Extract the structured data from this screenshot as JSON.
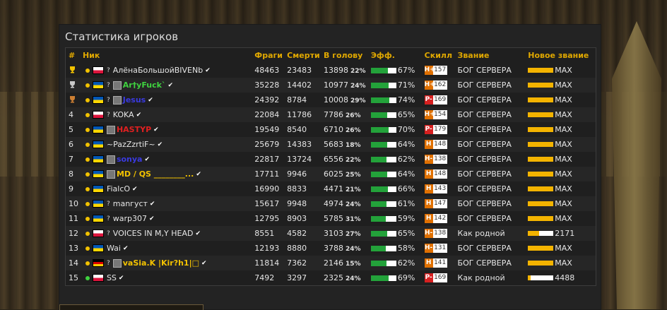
{
  "panel": {
    "title": "Статистика игроков"
  },
  "headers": {
    "num": "#",
    "nick": "Ник",
    "frags": "Фраги",
    "deaths": "Смерти",
    "hs": "В голову",
    "eff": "Эфф.",
    "skill": "Скилл",
    "rank": "Звание",
    "newrank": "Новое звание"
  },
  "colors": {
    "header": "#e0a800",
    "eff_bar": "#23a23a",
    "rank_bar": "#f4b400",
    "skill_h": "#e07000",
    "skill_p": "#d62020"
  },
  "rows": [
    {
      "num": "",
      "trophy": "gold-trophy-icon",
      "dot": "#f2c200",
      "flag": "poland",
      "q": "?",
      "avatar": "",
      "nick": "АлёнаБольшойBIVENb",
      "nick_color": "#e6e6e6",
      "frags": "48463",
      "deaths": "23483",
      "hs": "13898",
      "hs_pct": "22%",
      "eff": "67%",
      "eff_val": 0.67,
      "skill_letter": "H+",
      "skill_color": "#e07000",
      "skill": "157",
      "rank": "БОГ СЕРВЕРА",
      "newrank": "MAX",
      "newrank_val": 1.0
    },
    {
      "num": "",
      "trophy": "silver-trophy-icon",
      "dot": "#f2c200",
      "flag": "ukraine",
      "q": "?",
      "avatar": "avatar-icon",
      "nick": "Ar†yFuck`",
      "nick_color": "#3fd23f",
      "frags": "35228",
      "deaths": "14402",
      "hs": "10977",
      "hs_pct": "24%",
      "eff": "71%",
      "eff_val": 0.71,
      "skill_letter": "H+",
      "skill_color": "#e07000",
      "skill": "162",
      "rank": "БОГ СЕРВЕРА",
      "newrank": "MAX",
      "newrank_val": 1.0
    },
    {
      "num": "",
      "trophy": "bronze-trophy-icon",
      "dot": "#f2c200",
      "flag": "ukraine",
      "q": "?",
      "avatar": "avatar-icon",
      "nick": "Jesus",
      "nick_color": "#3a3ae0",
      "frags": "24392",
      "deaths": "8784",
      "hs": "10008",
      "hs_pct": "29%",
      "eff": "74%",
      "eff_val": 0.74,
      "skill_letter": "P-",
      "skill_color": "#d62020",
      "skill": "169",
      "rank": "БОГ СЕРВЕРА",
      "newrank": "MAX",
      "newrank_val": 1.0
    },
    {
      "num": "4",
      "trophy": "",
      "dot": "#f2c200",
      "flag": "poland",
      "q": "?",
      "avatar": "",
      "nick": "KOKA",
      "nick_color": "#e6e6e6",
      "frags": "22084",
      "deaths": "11786",
      "hs": "7786",
      "hs_pct": "26%",
      "eff": "65%",
      "eff_val": 0.65,
      "skill_letter": "H+",
      "skill_color": "#e07000",
      "skill": "154",
      "rank": "БОГ СЕРВЕРА",
      "newrank": "MAX",
      "newrank_val": 1.0
    },
    {
      "num": "5",
      "trophy": "",
      "dot": "#f2c200",
      "flag": "ukraine",
      "q": "",
      "avatar": "avatar-icon",
      "nick": "HASTYP",
      "nick_color": "#e02020",
      "frags": "19549",
      "deaths": "8540",
      "hs": "6710",
      "hs_pct": "26%",
      "eff": "70%",
      "eff_val": 0.7,
      "skill_letter": "P-",
      "skill_color": "#d62020",
      "skill": "179",
      "rank": "БОГ СЕРВЕРА",
      "newrank": "MAX",
      "newrank_val": 1.0
    },
    {
      "num": "6",
      "trophy": "",
      "dot": "#f2c200",
      "flag": "ukraine",
      "q": "",
      "avatar": "",
      "nick": "~PazZzrtiF~",
      "nick_color": "#e6e6e6",
      "frags": "25679",
      "deaths": "14383",
      "hs": "5683",
      "hs_pct": "18%",
      "eff": "64%",
      "eff_val": 0.64,
      "skill_letter": "H",
      "skill_color": "#e07000",
      "skill": "148",
      "rank": "БОГ СЕРВЕРА",
      "newrank": "MAX",
      "newrank_val": 1.0
    },
    {
      "num": "7",
      "trophy": "",
      "dot": "#f2c200",
      "flag": "ukraine",
      "q": "",
      "avatar": "avatar-icon",
      "nick": "sonya",
      "nick_color": "#3a3ae0",
      "frags": "22817",
      "deaths": "13724",
      "hs": "6556",
      "hs_pct": "22%",
      "eff": "62%",
      "eff_val": 0.62,
      "skill_letter": "H-",
      "skill_color": "#e07000",
      "skill": "138",
      "rank": "БОГ СЕРВЕРА",
      "newrank": "MAX",
      "newrank_val": 1.0
    },
    {
      "num": "8",
      "trophy": "",
      "dot": "#f2c200",
      "flag": "ukraine",
      "q": "",
      "avatar": "avatar-icon",
      "nick": "MD / QS ________...",
      "nick_color": "#f2c200",
      "frags": "17711",
      "deaths": "9946",
      "hs": "6025",
      "hs_pct": "25%",
      "eff": "64%",
      "eff_val": 0.64,
      "skill_letter": "H",
      "skill_color": "#e07000",
      "skill": "148",
      "rank": "БОГ СЕРВЕРА",
      "newrank": "MAX",
      "newrank_val": 1.0
    },
    {
      "num": "9",
      "trophy": "",
      "dot": "#f2c200",
      "flag": "ukraine",
      "q": "",
      "avatar": "",
      "nick": "FialcO",
      "nick_color": "#e6e6e6",
      "frags": "16990",
      "deaths": "8833",
      "hs": "4471",
      "hs_pct": "21%",
      "eff": "66%",
      "eff_val": 0.66,
      "skill_letter": "H",
      "skill_color": "#e07000",
      "skill": "143",
      "rank": "БОГ СЕРВЕРА",
      "newrank": "MAX",
      "newrank_val": 1.0
    },
    {
      "num": "10",
      "trophy": "",
      "dot": "#f2c200",
      "flag": "ukraine",
      "q": "?",
      "avatar": "",
      "nick": "manгуст",
      "nick_color": "#e6e6e6",
      "frags": "15617",
      "deaths": "9948",
      "hs": "4974",
      "hs_pct": "24%",
      "eff": "61%",
      "eff_val": 0.61,
      "skill_letter": "H",
      "skill_color": "#e07000",
      "skill": "147",
      "rank": "БОГ СЕРВЕРА",
      "newrank": "MAX",
      "newrank_val": 1.0
    },
    {
      "num": "11",
      "trophy": "",
      "dot": "#f2c200",
      "flag": "ukraine",
      "q": "?",
      "avatar": "",
      "nick": "warp307",
      "nick_color": "#e6e6e6",
      "frags": "12795",
      "deaths": "8903",
      "hs": "5785",
      "hs_pct": "31%",
      "eff": "59%",
      "eff_val": 0.59,
      "skill_letter": "H",
      "skill_color": "#e07000",
      "skill": "142",
      "rank": "БОГ СЕРВЕРА",
      "newrank": "MAX",
      "newrank_val": 1.0
    },
    {
      "num": "12",
      "trophy": "",
      "dot": "#f2c200",
      "flag": "poland",
      "q": "?",
      "avatar": "",
      "nick": "VOICES IN M,Y HEAD",
      "nick_color": "#e6e6e6",
      "frags": "8551",
      "deaths": "4582",
      "hs": "3103",
      "hs_pct": "27%",
      "eff": "65%",
      "eff_val": 0.65,
      "skill_letter": "H-",
      "skill_color": "#e07000",
      "skill": "138",
      "rank": "Как родной",
      "newrank": "2171",
      "newrank_val": 0.45
    },
    {
      "num": "13",
      "trophy": "",
      "dot": "#f2c200",
      "flag": "ukraine",
      "q": "",
      "avatar": "",
      "nick": "Wai",
      "nick_color": "#e6e6e6",
      "frags": "12193",
      "deaths": "8880",
      "hs": "3788",
      "hs_pct": "24%",
      "eff": "58%",
      "eff_val": 0.58,
      "skill_letter": "H-",
      "skill_color": "#e07000",
      "skill": "131",
      "rank": "БОГ СЕРВЕРА",
      "newrank": "MAX",
      "newrank_val": 1.0
    },
    {
      "num": "14",
      "trophy": "",
      "dot": "#f2c200",
      "flag": "germany",
      "q": "?",
      "avatar": "avatar-icon",
      "nick": "vaSia.K |Kir?h1|□",
      "nick_color": "#f2c200",
      "frags": "11814",
      "deaths": "7362",
      "hs": "2146",
      "hs_pct": "15%",
      "eff": "62%",
      "eff_val": 0.62,
      "skill_letter": "H",
      "skill_color": "#e07000",
      "skill": "141",
      "rank": "БОГ СЕРВЕРА",
      "newrank": "MAX",
      "newrank_val": 1.0
    },
    {
      "num": "15",
      "trophy": "",
      "dot": "#3fd23f",
      "flag": "poland",
      "q": "",
      "avatar": "",
      "nick": "SS",
      "nick_color": "#e6e6e6",
      "frags": "7492",
      "deaths": "3297",
      "hs": "2325",
      "hs_pct": "24%",
      "eff": "69%",
      "eff_val": 0.69,
      "skill_letter": "P-",
      "skill_color": "#d62020",
      "skill": "169",
      "rank": "Как родной",
      "newrank": "4488",
      "newrank_val": 0.1
    }
  ]
}
